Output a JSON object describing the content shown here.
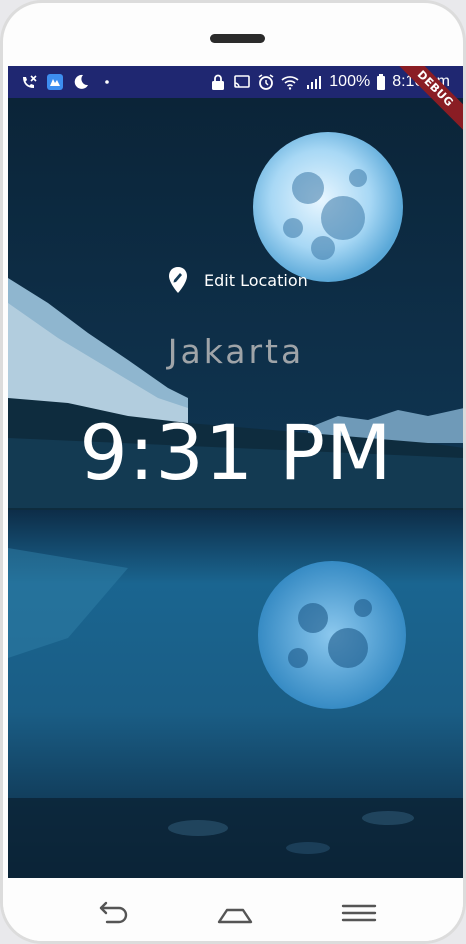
{
  "status_bar": {
    "battery": "100%",
    "time": "8:16 pm",
    "icons": [
      "missed-call-icon",
      "app-icon",
      "moon-icon",
      "dot-icon",
      "alarm-lock-icon",
      "cast-icon",
      "alarm-icon",
      "wifi-icon",
      "signal-icon",
      "battery-icon"
    ]
  },
  "debug_banner": "DEBUG",
  "location": {
    "edit_label": "Edit Location",
    "icon": "location-edit-icon",
    "city": "Jakarta",
    "time": "9:31 PM"
  },
  "nav": {
    "back_icon": "back-icon",
    "home_icon": "home-icon",
    "menu_icon": "menu-icon"
  },
  "colors": {
    "status_bar": "#1f2771",
    "debug_ribbon": "#8a1d24",
    "city_text": "#9fa4a8",
    "time_text": "#ffffff"
  }
}
